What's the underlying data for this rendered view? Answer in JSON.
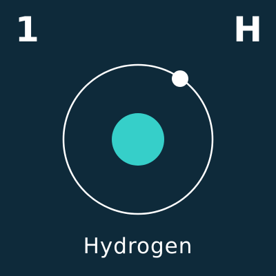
{
  "element": {
    "atomic_number": "1",
    "symbol": "H",
    "name": "Hydrogen"
  },
  "colors": {
    "background": "#0e2a3a",
    "nucleus": "#36cfc9",
    "electron": "#ffffff",
    "orbit": "#ffffff",
    "text": "#ffffff"
  },
  "diagram": {
    "nucleus_icon": "nucleus",
    "electron_icon": "electron",
    "orbit_count": 1,
    "electron_count": 1
  }
}
